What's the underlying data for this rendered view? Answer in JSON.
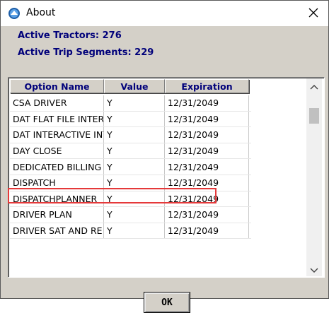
{
  "window": {
    "title": "About",
    "close_icon": "close-icon",
    "app_icon": "app-icon"
  },
  "stats": {
    "active_tractors": "Active Tractors: 276",
    "active_trip_segments": "Active Trip Segments: 229"
  },
  "table": {
    "columns": [
      "Option Name",
      "Value",
      "Expiration"
    ],
    "rows": [
      [
        "CSA DRIVER",
        "Y",
        "12/31/2049"
      ],
      [
        "DAT FLAT FILE INTER",
        "Y",
        "12/31/2049"
      ],
      [
        "DAT INTERACTIVE INT",
        "Y",
        "12/31/2049"
      ],
      [
        "DAY CLOSE",
        "Y",
        "12/31/2049"
      ],
      [
        "DEDICATED BILLING",
        "Y",
        "12/31/2049"
      ],
      [
        "DISPATCH",
        "Y",
        "12/31/2049"
      ],
      [
        "DISPATCHPLANNER",
        "Y",
        "12/31/2049"
      ],
      [
        "DRIVER PLAN",
        "Y",
        "12/31/2049"
      ],
      [
        "DRIVER SAT AND RE",
        "Y",
        "12/31/2049"
      ]
    ],
    "highlighted_row": "DEDICATED BILLING",
    "highlight_color": "#e5393a"
  },
  "buttons": {
    "ok_label": "OK"
  },
  "colors": {
    "header_text": "#00007a",
    "stat_text": "#00007a"
  }
}
